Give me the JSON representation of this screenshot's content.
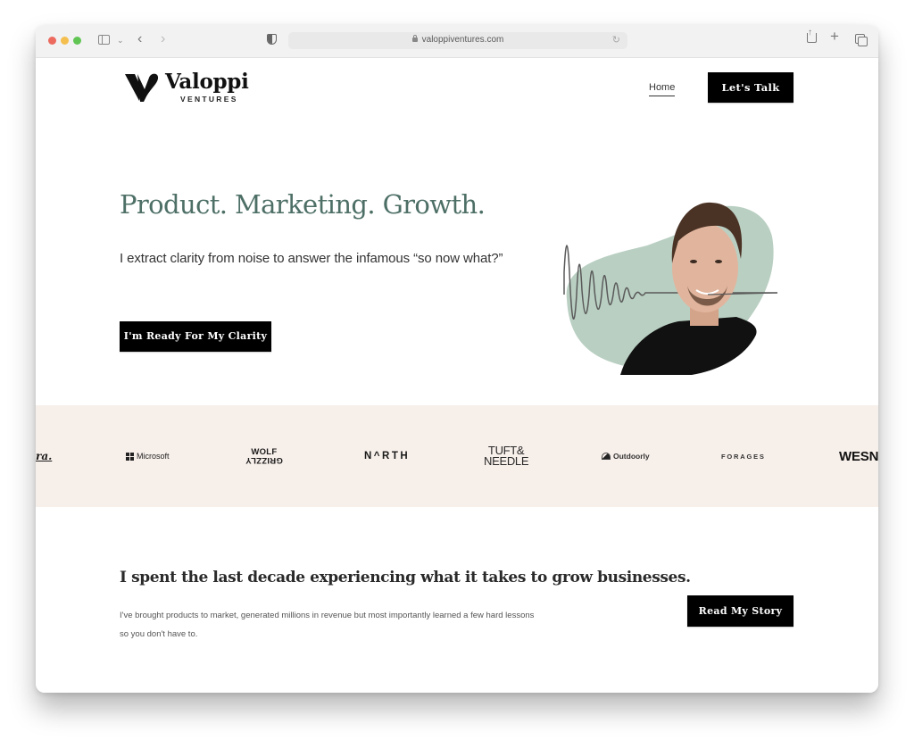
{
  "browser": {
    "url": "valoppiventures.com",
    "icons": [
      "sidebar-icon",
      "chevron-down-icon",
      "back-icon",
      "forward-icon",
      "shield-icon",
      "lock-icon",
      "reload-icon",
      "share-icon",
      "new-tab-icon",
      "tabs-icon"
    ]
  },
  "header": {
    "logo_name": "Valoppi",
    "logo_sub": "VENTURES",
    "nav_home": "Home",
    "cta_label": "Let's Talk"
  },
  "hero": {
    "title": "Product. Marketing. Growth.",
    "subtitle": "I extract clarity from noise to answer the infamous “so now what?”",
    "cta_label": "I'm Ready For My Clarity",
    "blob_color": "#b9cfc2"
  },
  "clients": {
    "background": "#f7efea",
    "logos": {
      "partial": "ra.",
      "microsoft": "Microsoft",
      "wolf_top": "WOLF",
      "wolf_bottom": "GRIZZLY",
      "north": "N^RTH",
      "tuft_top": "TUFT&",
      "tuft_bottom": "NEEDLE",
      "outdoorly": "Outdoorly",
      "forages": "FORAGES",
      "wesn": "WESN"
    }
  },
  "story": {
    "title": "I spent the last decade experiencing what it takes to grow businesses.",
    "text": "I've brought products to market, generated millions in revenue but most importantly learned a few hard lessons so you don't have to.",
    "cta_label": "Read My Story"
  },
  "colors": {
    "accent_green": "#4d6f66",
    "button_black": "#000000"
  }
}
